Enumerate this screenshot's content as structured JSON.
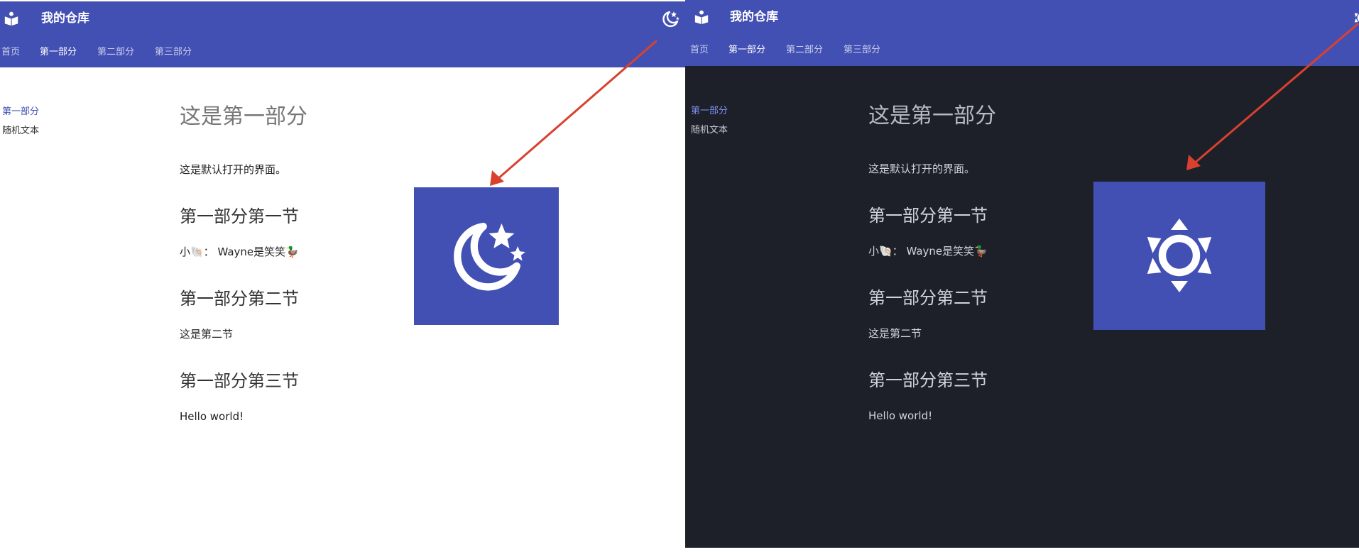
{
  "header": {
    "title": "我的仓库",
    "tabs": [
      "首页",
      "第一部分",
      "第二部分",
      "第三部分"
    ]
  },
  "toc": {
    "items": [
      "第一部分",
      "随机文本"
    ]
  },
  "content": {
    "heading": "这是第一部分",
    "intro": "这是默认打开的界面。",
    "section1_title": "第一部分第一节",
    "section1_text": "小🐚： Wayne是笑笑🦆",
    "section2_title": "第一部分第二节",
    "section2_text": "这是第二节",
    "section3_title": "第一部分第三节",
    "section3_text": "Hello world!"
  },
  "colors": {
    "primary": "#4350b3",
    "dark_background": "#1e2029",
    "arrow": "#d9412e"
  },
  "icons": {
    "logo": "book-icon",
    "light_mode_toggle": "moon-stars-icon",
    "dark_mode_toggle": "sun-icon"
  }
}
